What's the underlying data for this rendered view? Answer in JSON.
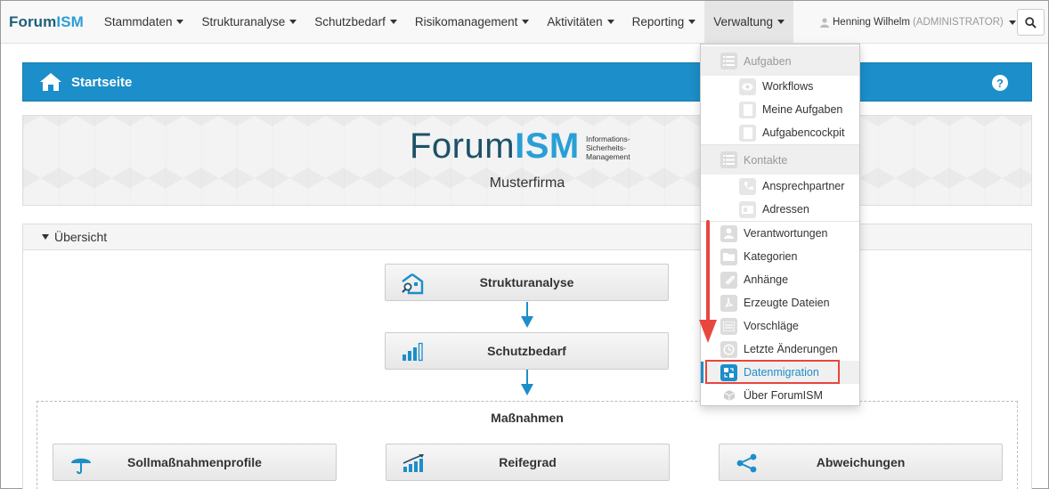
{
  "brand": {
    "part1": "Forum",
    "part2": "ISM"
  },
  "nav": {
    "items": [
      {
        "label": "Stammdaten"
      },
      {
        "label": "Strukturanalyse"
      },
      {
        "label": "Schutzbedarf"
      },
      {
        "label": "Risikomanagement"
      },
      {
        "label": "Aktivitäten"
      },
      {
        "label": "Reporting"
      },
      {
        "label": "Verwaltung"
      }
    ],
    "user_name": "Henning Wilhelm",
    "user_role": "(ADMINISTRATOR)",
    "search_icon": "search-icon"
  },
  "header": {
    "title": "Startseite",
    "help": "?"
  },
  "banner": {
    "logo_part1": "Forum",
    "logo_part2": "ISM",
    "logo_sub": [
      "Informations-",
      "Sicherheits-",
      "Management"
    ],
    "company": "Musterfirma"
  },
  "overview": {
    "title": "Übersicht",
    "tiles": {
      "strukturanalyse": "Strukturanalyse",
      "schutzbedarf": "Schutzbedarf",
      "sollmassnahmen": "Sollmaßnahmenprofile",
      "reifegrad": "Reifegrad",
      "abweichungen": "Abweichungen"
    },
    "massnahmen_title": "Maßnahmen"
  },
  "dropdown": {
    "aufgaben_head": "Aufgaben",
    "workflows": "Workflows",
    "meine_aufgaben": "Meine Aufgaben",
    "aufgabencockpit": "Aufgabencockpit",
    "kontakte_head": "Kontakte",
    "ansprechpartner": "Ansprechpartner",
    "adressen": "Adressen",
    "verantwortungen": "Verantwortungen",
    "kategorien": "Kategorien",
    "anhaenge": "Anhänge",
    "erzeugte_dateien": "Erzeugte Dateien",
    "vorschlaege": "Vorschläge",
    "letzte_aenderungen": "Letzte Änderungen",
    "datenmigration": "Datenmigration",
    "ueber": "Über ForumISM"
  },
  "colors": {
    "accent": "#1c8ec9",
    "brand_dark": "#1d5268",
    "highlight": "#e8463f"
  }
}
